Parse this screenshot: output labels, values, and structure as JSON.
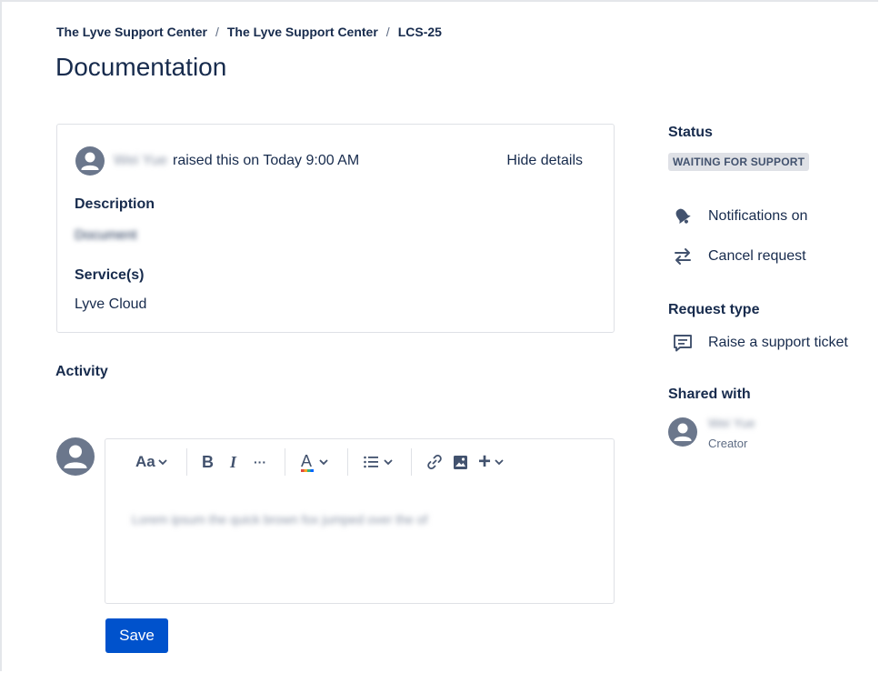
{
  "breadcrumb": {
    "items": [
      "The Lyve Support Center",
      "The Lyve Support Center",
      "LCS-25"
    ],
    "separator": "/"
  },
  "page_title": "Documentation",
  "details": {
    "reporter": "Wei Yue",
    "raised_text": "raised this on Today 9:00 AM",
    "hide_details_label": "Hide details",
    "description_label": "Description",
    "description_value": "Document",
    "services_label": "Service(s)",
    "services_value": "Lyve Cloud"
  },
  "activity": {
    "title": "Activity",
    "toolbar": {
      "text_style": "Aa",
      "bold": "B",
      "italic": "I",
      "more": "···",
      "text_color": "A",
      "list": "list-icon",
      "link": "link-icon",
      "image": "image-icon",
      "insert": "+"
    },
    "comment_text": "Lorem ipsum the quick brown fox jumped over the of",
    "save_label": "Save"
  },
  "sidebar": {
    "status_label": "Status",
    "status_value": "WAITING FOR SUPPORT",
    "notifications_label": "Notifications on",
    "cancel_label": "Cancel request",
    "request_type_label": "Request type",
    "request_type_value": "Raise a support ticket",
    "shared_with_label": "Shared with",
    "shared_name": "Wei Yue",
    "shared_role": "Creator"
  },
  "colors": {
    "primary": "#0052cc",
    "text": "#172b4d",
    "badge_bg": "#dfe1e6",
    "avatar": "#6b778c"
  }
}
